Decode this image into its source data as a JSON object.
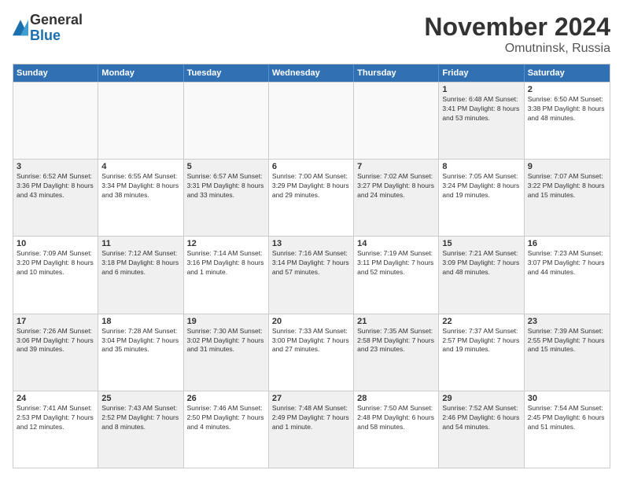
{
  "header": {
    "logo_general": "General",
    "logo_blue": "Blue",
    "month_title": "November 2024",
    "location": "Omutninsk, Russia"
  },
  "weekdays": [
    "Sunday",
    "Monday",
    "Tuesday",
    "Wednesday",
    "Thursday",
    "Friday",
    "Saturday"
  ],
  "rows": [
    [
      {
        "day": "",
        "info": "",
        "empty": true
      },
      {
        "day": "",
        "info": "",
        "empty": true
      },
      {
        "day": "",
        "info": "",
        "empty": true
      },
      {
        "day": "",
        "info": "",
        "empty": true
      },
      {
        "day": "",
        "info": "",
        "empty": true
      },
      {
        "day": "1",
        "info": "Sunrise: 6:48 AM\nSunset: 3:41 PM\nDaylight: 8 hours and 53 minutes.",
        "shaded": true
      },
      {
        "day": "2",
        "info": "Sunrise: 6:50 AM\nSunset: 3:38 PM\nDaylight: 8 hours and 48 minutes.",
        "shaded": false
      }
    ],
    [
      {
        "day": "3",
        "info": "Sunrise: 6:52 AM\nSunset: 3:36 PM\nDaylight: 8 hours and 43 minutes.",
        "shaded": true
      },
      {
        "day": "4",
        "info": "Sunrise: 6:55 AM\nSunset: 3:34 PM\nDaylight: 8 hours and 38 minutes.",
        "shaded": false
      },
      {
        "day": "5",
        "info": "Sunrise: 6:57 AM\nSunset: 3:31 PM\nDaylight: 8 hours and 33 minutes.",
        "shaded": true
      },
      {
        "day": "6",
        "info": "Sunrise: 7:00 AM\nSunset: 3:29 PM\nDaylight: 8 hours and 29 minutes.",
        "shaded": false
      },
      {
        "day": "7",
        "info": "Sunrise: 7:02 AM\nSunset: 3:27 PM\nDaylight: 8 hours and 24 minutes.",
        "shaded": true
      },
      {
        "day": "8",
        "info": "Sunrise: 7:05 AM\nSunset: 3:24 PM\nDaylight: 8 hours and 19 minutes.",
        "shaded": false
      },
      {
        "day": "9",
        "info": "Sunrise: 7:07 AM\nSunset: 3:22 PM\nDaylight: 8 hours and 15 minutes.",
        "shaded": true
      }
    ],
    [
      {
        "day": "10",
        "info": "Sunrise: 7:09 AM\nSunset: 3:20 PM\nDaylight: 8 hours and 10 minutes.",
        "shaded": false
      },
      {
        "day": "11",
        "info": "Sunrise: 7:12 AM\nSunset: 3:18 PM\nDaylight: 8 hours and 6 minutes.",
        "shaded": true
      },
      {
        "day": "12",
        "info": "Sunrise: 7:14 AM\nSunset: 3:16 PM\nDaylight: 8 hours and 1 minute.",
        "shaded": false
      },
      {
        "day": "13",
        "info": "Sunrise: 7:16 AM\nSunset: 3:14 PM\nDaylight: 7 hours and 57 minutes.",
        "shaded": true
      },
      {
        "day": "14",
        "info": "Sunrise: 7:19 AM\nSunset: 3:11 PM\nDaylight: 7 hours and 52 minutes.",
        "shaded": false
      },
      {
        "day": "15",
        "info": "Sunrise: 7:21 AM\nSunset: 3:09 PM\nDaylight: 7 hours and 48 minutes.",
        "shaded": true
      },
      {
        "day": "16",
        "info": "Sunrise: 7:23 AM\nSunset: 3:07 PM\nDaylight: 7 hours and 44 minutes.",
        "shaded": false
      }
    ],
    [
      {
        "day": "17",
        "info": "Sunrise: 7:26 AM\nSunset: 3:06 PM\nDaylight: 7 hours and 39 minutes.",
        "shaded": true
      },
      {
        "day": "18",
        "info": "Sunrise: 7:28 AM\nSunset: 3:04 PM\nDaylight: 7 hours and 35 minutes.",
        "shaded": false
      },
      {
        "day": "19",
        "info": "Sunrise: 7:30 AM\nSunset: 3:02 PM\nDaylight: 7 hours and 31 minutes.",
        "shaded": true
      },
      {
        "day": "20",
        "info": "Sunrise: 7:33 AM\nSunset: 3:00 PM\nDaylight: 7 hours and 27 minutes.",
        "shaded": false
      },
      {
        "day": "21",
        "info": "Sunrise: 7:35 AM\nSunset: 2:58 PM\nDaylight: 7 hours and 23 minutes.",
        "shaded": true
      },
      {
        "day": "22",
        "info": "Sunrise: 7:37 AM\nSunset: 2:57 PM\nDaylight: 7 hours and 19 minutes.",
        "shaded": false
      },
      {
        "day": "23",
        "info": "Sunrise: 7:39 AM\nSunset: 2:55 PM\nDaylight: 7 hours and 15 minutes.",
        "shaded": true
      }
    ],
    [
      {
        "day": "24",
        "info": "Sunrise: 7:41 AM\nSunset: 2:53 PM\nDaylight: 7 hours and 12 minutes.",
        "shaded": false
      },
      {
        "day": "25",
        "info": "Sunrise: 7:43 AM\nSunset: 2:52 PM\nDaylight: 7 hours and 8 minutes.",
        "shaded": true
      },
      {
        "day": "26",
        "info": "Sunrise: 7:46 AM\nSunset: 2:50 PM\nDaylight: 7 hours and 4 minutes.",
        "shaded": false
      },
      {
        "day": "27",
        "info": "Sunrise: 7:48 AM\nSunset: 2:49 PM\nDaylight: 7 hours and 1 minute.",
        "shaded": true
      },
      {
        "day": "28",
        "info": "Sunrise: 7:50 AM\nSunset: 2:48 PM\nDaylight: 6 hours and 58 minutes.",
        "shaded": false
      },
      {
        "day": "29",
        "info": "Sunrise: 7:52 AM\nSunset: 2:46 PM\nDaylight: 6 hours and 54 minutes.",
        "shaded": true
      },
      {
        "day": "30",
        "info": "Sunrise: 7:54 AM\nSunset: 2:45 PM\nDaylight: 6 hours and 51 minutes.",
        "shaded": false
      }
    ]
  ]
}
